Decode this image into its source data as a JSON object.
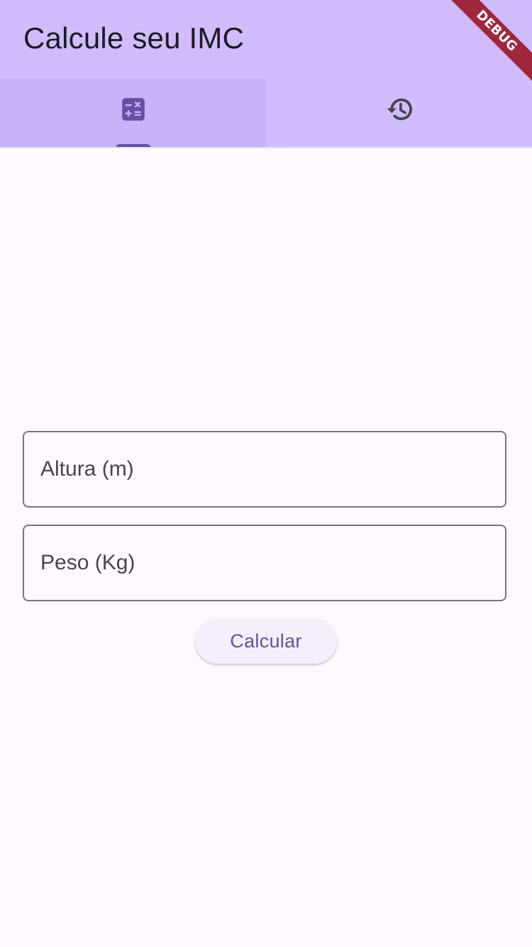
{
  "app": {
    "title": "Calcule seu IMC",
    "debug_label": "DEBUG"
  },
  "tabs": [
    {
      "icon": "calculate-icon",
      "active": true
    },
    {
      "icon": "history-icon",
      "active": false
    }
  ],
  "form": {
    "altura": {
      "placeholder": "Altura (m)",
      "value": ""
    },
    "peso": {
      "placeholder": "Peso (Kg)",
      "value": ""
    },
    "calculate_label": "Calcular"
  },
  "colors": {
    "appbar": "#D0BCFF",
    "active_tab": "#C6B2F6",
    "accent": "#6750A4",
    "background": "#FFF9FF",
    "debug_ribbon": "#A0283C"
  }
}
